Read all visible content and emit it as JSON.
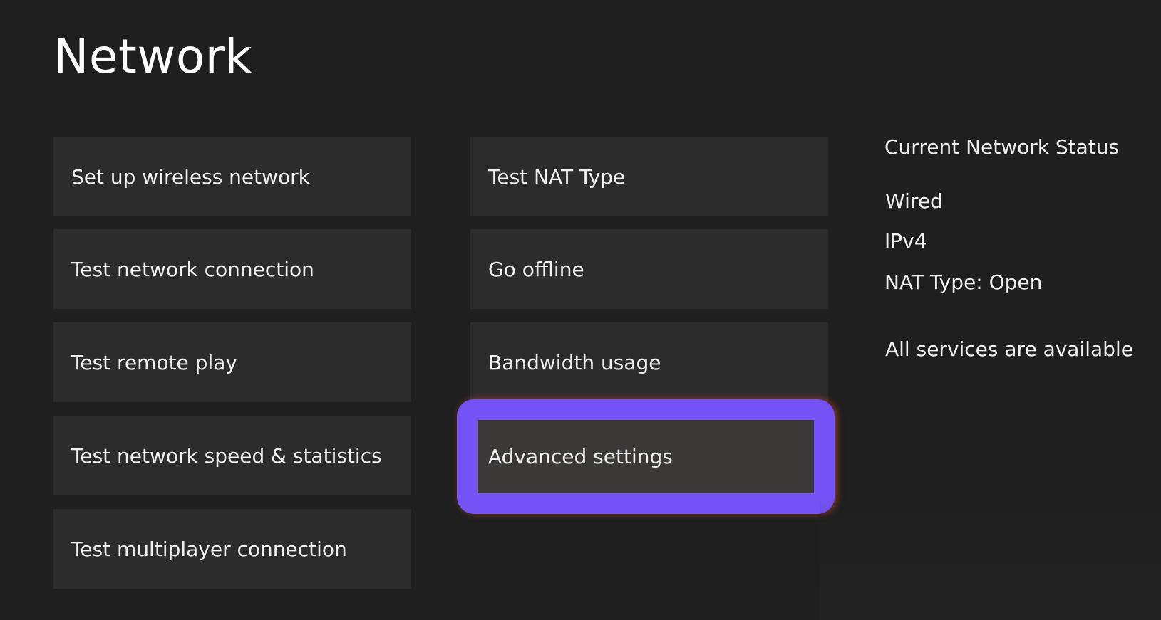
{
  "page": {
    "title": "Network"
  },
  "menu": {
    "left_column": [
      {
        "label": "Set up wireless network"
      },
      {
        "label": "Test network connection"
      },
      {
        "label": "Test remote play"
      },
      {
        "label": "Test network speed & statistics"
      },
      {
        "label": "Test multiplayer connection"
      }
    ],
    "right_column": [
      {
        "label": "Test NAT Type"
      },
      {
        "label": "Go offline"
      },
      {
        "label": "Bandwidth usage"
      },
      {
        "label": "Advanced settings",
        "focused": true
      }
    ]
  },
  "status": {
    "heading": "Current Network Status",
    "connection": "Wired",
    "ip_version": "IPv4",
    "nat_type": "NAT Type: Open",
    "services": "All services are available"
  },
  "colors": {
    "background": "#1f1f1f",
    "tile": "#2c2c2c",
    "focus_accent": "#7353f5"
  }
}
